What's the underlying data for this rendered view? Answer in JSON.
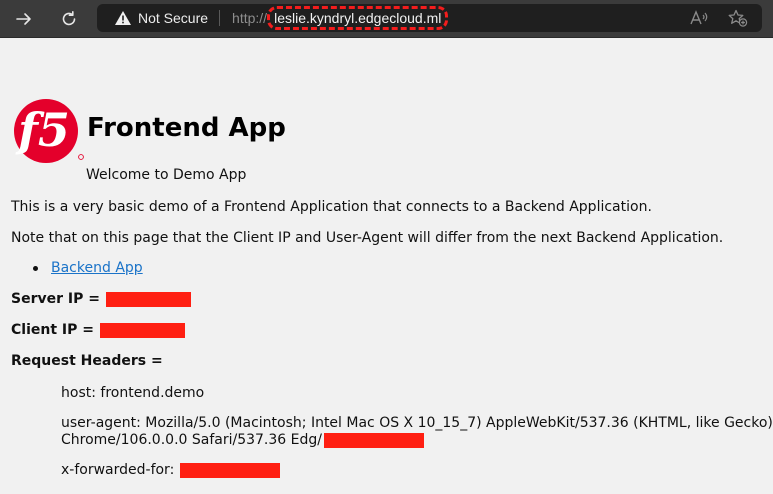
{
  "browser": {
    "security_label": "Not Secure",
    "url_scheme": "http://",
    "url_host": "leslie.kyndryl.edgecloud.ml",
    "icons": [
      "forward-icon",
      "refresh-icon",
      "warning-icon",
      "read-aloud-icon",
      "add-favorite-icon"
    ]
  },
  "page": {
    "title": "Frontend App",
    "welcome": "Welcome to Demo App",
    "description": "This is a very basic demo of a Frontend Application that connects to a Backend Application.",
    "note": "Note that on this page that the Client IP and User-Agent will differ from the next Backend Application.",
    "links": [
      {
        "label": "Backend App"
      }
    ],
    "server_ip_label": "Server IP =",
    "client_ip_label": "Client IP =",
    "request_headers_label": "Request Headers =",
    "headers": {
      "host": "host: frontend.demo",
      "user_agent_line1": "user-agent: Mozilla/5.0 (Macintosh; Intel Mac OS X 10_15_7) AppleWebKit/537.36 (KHTML, like Gecko)",
      "user_agent_line2": "Chrome/106.0.0.0 Safari/537.36 Edg/",
      "x_forwarded_for": "x-forwarded-for:"
    }
  },
  "colors": {
    "redaction": "#ff1f12",
    "logo_red": "#e4002b",
    "link": "#1a73c8",
    "toolbar": "#3b3b3b",
    "page_bg": "#f1f1f1"
  }
}
